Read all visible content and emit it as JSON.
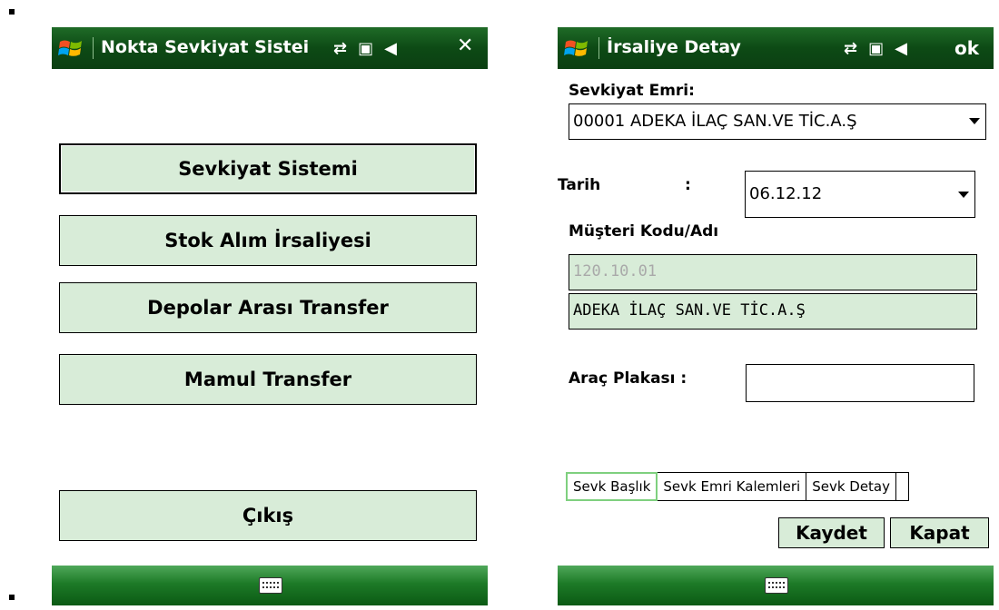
{
  "left": {
    "title": "Nokta Sevkiyat Sistei",
    "close_label": "✕",
    "menu": [
      {
        "label": "Sevkiyat Sistemi"
      },
      {
        "label": "Stok Alım İrsaliyesi"
      },
      {
        "label": "Depolar Arası Transfer"
      },
      {
        "label": "Mamul Transfer"
      },
      {
        "label": "Çıkış"
      }
    ]
  },
  "right": {
    "title": "İrsaliye Detay",
    "ok_label": "ok",
    "sevkiyat_emri_label": "Sevkiyat Emri:",
    "sevkiyat_emri_value": "00001 ADEKA İLAÇ SAN.VE TİC.A.Ş",
    "tarih_label": "Tarih",
    "tarih_colon": ":",
    "tarih_value": "06.12.12",
    "musteri_label": "Müşteri Kodu/Adı",
    "musteri_kodu": "120.10.01",
    "musteri_adi": "ADEKA İLAÇ SAN.VE TİC.A.Ş",
    "arac_plakasi_label": "Araç Plakası :",
    "arac_plakasi_value": "",
    "tabs": [
      "Sevk Başlık",
      "Sevk Emri Kalemleri",
      "Sevk Detay"
    ],
    "save_label": "Kaydet",
    "close_label": "Kapat"
  },
  "colors": {
    "titlebar": "#0d4a15",
    "button_bg": "#d8ecd8",
    "active_tab_border": "#7fd07f"
  },
  "icons": [
    "windows-flag-icon",
    "connectivity-icon",
    "signal-icon",
    "volume-icon",
    "keyboard-icon"
  ]
}
